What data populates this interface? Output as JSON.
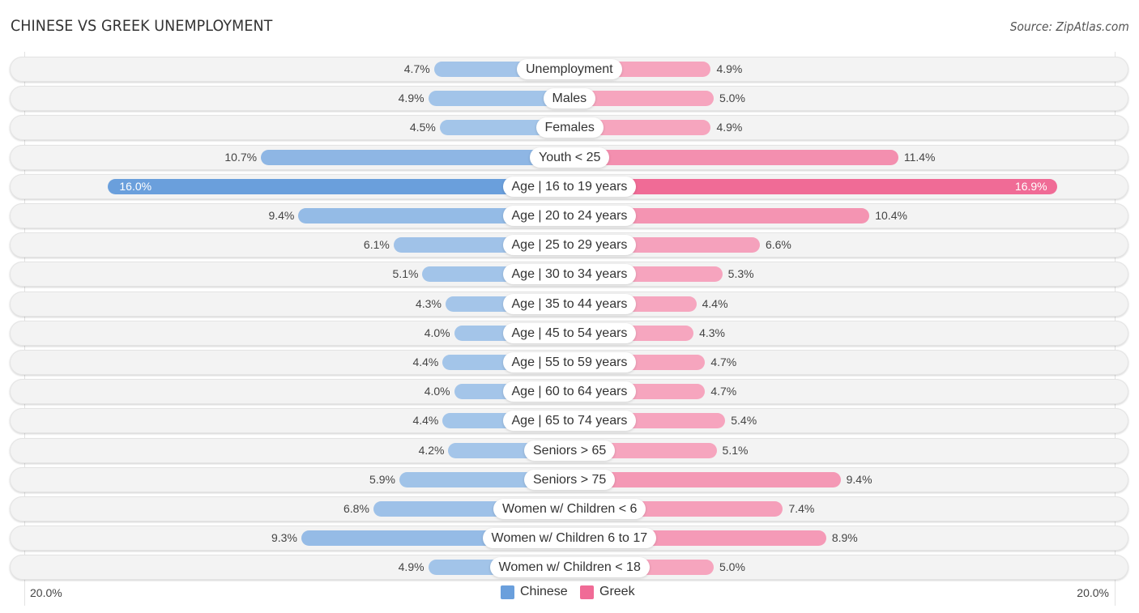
{
  "header": {
    "title": "CHINESE VS GREEK UNEMPLOYMENT",
    "source": "Source: ZipAtlas.com"
  },
  "colors": {
    "chinese_strong": "#6a9fdc",
    "chinese_light": "#a7c7ea",
    "greek_strong": "#f06b96",
    "greek_light": "#f6a9c1",
    "row_background": "#f3f3f3"
  },
  "chart_data": {
    "type": "bar",
    "orientation": "horizontal-diverging",
    "title": "CHINESE VS GREEK UNEMPLOYMENT",
    "xlabel": "",
    "ylabel": "",
    "axis_min_label": "20.0%",
    "axis_max_label": "20.0%",
    "xlim": [
      -20,
      20
    ],
    "grid": false,
    "legend_position": "bottom-center",
    "unit": "%",
    "categories": [
      "Unemployment",
      "Males",
      "Females",
      "Youth < 25",
      "Age | 16 to 19 years",
      "Age | 20 to 24 years",
      "Age | 25 to 29 years",
      "Age | 30 to 34 years",
      "Age | 35 to 44 years",
      "Age | 45 to 54 years",
      "Age | 55 to 59 years",
      "Age | 60 to 64 years",
      "Age | 65 to 74 years",
      "Seniors > 65",
      "Seniors > 75",
      "Women w/ Children < 6",
      "Women w/ Children 6 to 17",
      "Women w/ Children < 18"
    ],
    "series": [
      {
        "name": "Chinese",
        "side": "left",
        "values": [
          4.7,
          4.9,
          4.5,
          10.7,
          16.0,
          9.4,
          6.1,
          5.1,
          4.3,
          4.0,
          4.4,
          4.0,
          4.4,
          4.2,
          5.9,
          6.8,
          9.3,
          4.9
        ],
        "labels": [
          "4.7%",
          "4.9%",
          "4.5%",
          "10.7%",
          "16.0%",
          "9.4%",
          "6.1%",
          "5.1%",
          "4.3%",
          "4.0%",
          "4.4%",
          "4.0%",
          "4.4%",
          "4.2%",
          "5.9%",
          "6.8%",
          "9.3%",
          "4.9%"
        ]
      },
      {
        "name": "Greek",
        "side": "right",
        "values": [
          4.9,
          5.0,
          4.9,
          11.4,
          16.9,
          10.4,
          6.6,
          5.3,
          4.4,
          4.3,
          4.7,
          4.7,
          5.4,
          5.1,
          9.4,
          7.4,
          8.9,
          5.0
        ],
        "labels": [
          "4.9%",
          "5.0%",
          "4.9%",
          "11.4%",
          "16.9%",
          "10.4%",
          "6.6%",
          "5.3%",
          "4.4%",
          "4.3%",
          "4.7%",
          "4.7%",
          "5.4%",
          "5.1%",
          "9.4%",
          "7.4%",
          "8.9%",
          "5.0%"
        ]
      }
    ],
    "legend": [
      "Chinese",
      "Greek"
    ]
  }
}
